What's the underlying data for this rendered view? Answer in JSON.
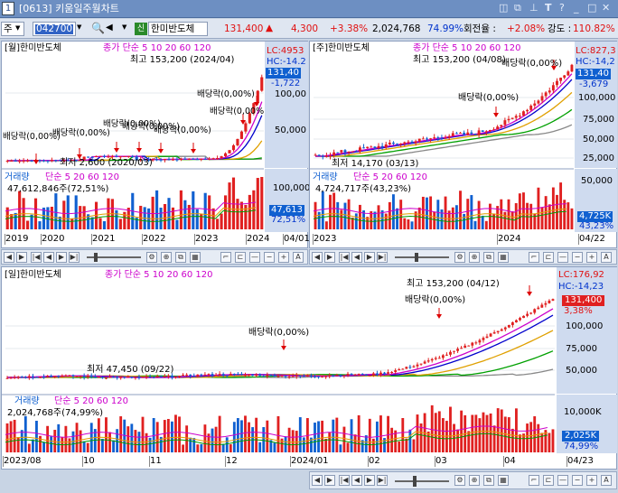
{
  "window": {
    "title": "[0613] 키움일주월차트",
    "number": "1",
    "icons": [
      "dual-window-icon",
      "copy-icon",
      "pin-icon",
      "text-icon",
      "help-icon",
      "minimize-icon",
      "maximize-icon",
      "close-icon"
    ]
  },
  "toolbar": {
    "market": "주",
    "code": "042700",
    "stock_name": "한미반도체",
    "price": "131,400",
    "change_mark": "▲",
    "change": "4,300",
    "change_pct": "+3.38%",
    "volume": "2,024,768",
    "vol_ratio": "74.99%",
    "turnover_label": "회전율 :",
    "turnover": "+2.08%",
    "strength_label": "강도 :",
    "strength": "110.82%"
  },
  "panes": {
    "monthly": {
      "title": "[월]한미반도체",
      "ma_label": "종가 단순 5 10 20 60 120",
      "lc": "LC:4953",
      "hc": "HC:-14.2",
      "price_tag": "131,40",
      "change_tag": "-1,722",
      "ticks": [
        "100,00",
        "50,000"
      ],
      "max_label": "최고 153,200 (2024/04)",
      "min_label": "최저 2,600 (2020/03)",
      "dividends": [
        "배당락(0,00%)",
        "배당락(0,00%)",
        "배당락(0,00%)",
        "배당락(0,00%)",
        "배당락(0,00%)",
        "배당락(0,00%)",
        "배당락(0,00%)"
      ],
      "vol_label": "거래량",
      "vol_ma": "단순 5 20 60 120",
      "vol_value": "47,612,846주(72,51%)",
      "vol_tick": "100,000",
      "vol_tag": "47,613",
      "vol_pct": "72,51%",
      "xaxis": [
        "2019",
        "2020",
        "2021",
        "2022",
        "2023",
        "2024",
        "04/01"
      ]
    },
    "weekly": {
      "title": "[주]한미반도체",
      "ma_label": "종가 단순 5 10 20 60 120",
      "lc": "LC:827,3",
      "hc": "HC:-14,2",
      "price_tag": "131,40",
      "change_tag": "-3,679",
      "ticks": [
        "100,000",
        "75,000",
        "50,000",
        "25,000"
      ],
      "max_label": "최고 153,200 (04/08)",
      "min_label": "최저 14,170 (03/13)",
      "dividends": [
        "배당락(0,00%)",
        "배당락(0,00%)"
      ],
      "vol_label": "거래량",
      "vol_ma": "단순 5 20 60 120",
      "vol_value": "4,724,717주(43,23%)",
      "vol_tick": "50,000",
      "vol_tag": "4,725K",
      "vol_pct": "43,23%",
      "xaxis": [
        "2023",
        "2024",
        "04/22"
      ]
    },
    "daily": {
      "title": "[일]한미반도체",
      "ma_label": "종가 단순 5 10 20 60 120",
      "lc": "LC:176,92",
      "hc": "HC:-14,23",
      "price_tag": "131,400",
      "change_tag": "3,38%",
      "ticks": [
        "100,000",
        "75,000",
        "50,000"
      ],
      "max_label": "최고 153,200 (04/12)",
      "min_label": "최저 47,450 (09/22)",
      "dividends": [
        "배당락(0,00%)",
        "배당락(0,00%)"
      ],
      "vol_label": "거래량",
      "vol_ma": "단순 5 20 60 120",
      "vol_value": "2,024,768주(74,99%)",
      "vol_tick": "10,000K",
      "vol_tag": "2,025K",
      "vol_pct": "74,99%",
      "xaxis": [
        "2023/08",
        "10",
        "11",
        "12",
        "2024/01",
        "02",
        "03",
        "04",
        "04/23"
      ]
    }
  },
  "colors": {
    "up": "#e02020",
    "down": "#1060d0",
    "ma5": "#cc00cc",
    "ma10": "#0000cc",
    "ma20": "#e0a000",
    "ma60": "#00a000",
    "ma120": "#888888"
  }
}
